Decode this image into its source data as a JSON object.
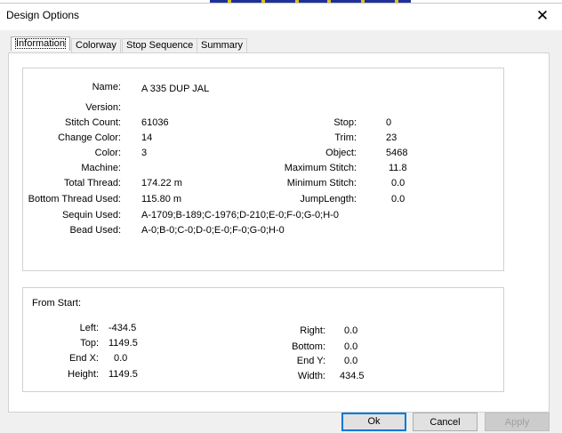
{
  "window": {
    "title": "Design Options",
    "close_glyph": "✕"
  },
  "tabs": [
    {
      "label": "Information",
      "active": true
    },
    {
      "label": "Colorway",
      "active": false
    },
    {
      "label": "Stop Sequence",
      "active": false
    },
    {
      "label": "Summary",
      "active": false
    }
  ],
  "info": {
    "name": {
      "label": "Name:",
      "value": "A 335 DUP JAL"
    },
    "version": {
      "label": "Version:",
      "value": ""
    },
    "stitch_count": {
      "label": "Stitch Count:",
      "value": "61036"
    },
    "change_color": {
      "label": "Change Color:",
      "value": "14"
    },
    "color": {
      "label": "Color:",
      "value": "3"
    },
    "machine": {
      "label": "Machine:",
      "value": ""
    },
    "total_thread": {
      "label": "Total Thread:",
      "value": "174.22 m"
    },
    "bottom_thread": {
      "label": "Bottom Thread Used:",
      "value": "115.80 m"
    },
    "sequin_used": {
      "label": "Sequin Used:",
      "value": "A-1709;B-189;C-1976;D-210;E-0;F-0;G-0;H-0"
    },
    "bead_used": {
      "label": "Bead Used:",
      "value": "A-0;B-0;C-0;D-0;E-0;F-0;G-0;H-0"
    },
    "stop": {
      "label": "Stop:",
      "value": "0"
    },
    "trim": {
      "label": "Trim:",
      "value": "23"
    },
    "object": {
      "label": "Object:",
      "value": "5468"
    },
    "max_stitch": {
      "label": "Maximum Stitch:",
      "value": "11.8"
    },
    "min_stitch": {
      "label": "Minimum Stitch:",
      "value": "0.0"
    },
    "jump_length": {
      "label": "JumpLength:",
      "value": "0.0"
    }
  },
  "from_start": {
    "heading": "From Start:",
    "left": {
      "label": "Left:",
      "value": "-434.5"
    },
    "top": {
      "label": "Top:",
      "value": "1149.5"
    },
    "end_x": {
      "label": "End X:",
      "value": "0.0"
    },
    "height": {
      "label": "Height:",
      "value": "1149.5"
    },
    "right": {
      "label": "Right:",
      "value": "0.0"
    },
    "bottom": {
      "label": "Bottom:",
      "value": "0.0"
    },
    "end_y": {
      "label": "End Y:",
      "value": "0.0"
    },
    "width": {
      "label": "Width:",
      "value": "434.5"
    }
  },
  "buttons": {
    "ok": "Ok",
    "cancel": "Cancel",
    "apply": "Apply"
  },
  "colors": {
    "accent": "#0078d7",
    "dialog_bg": "#f0f0f0"
  }
}
